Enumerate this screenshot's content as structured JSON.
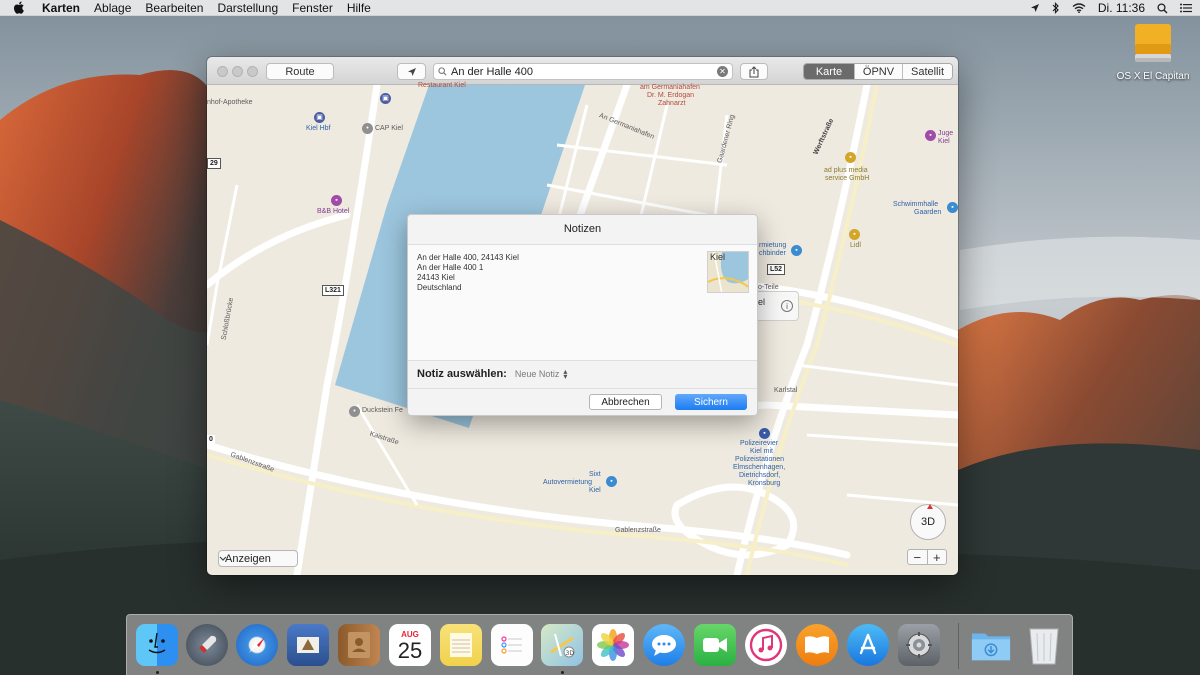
{
  "menubar": {
    "app_name": "Karten",
    "menus": [
      "Ablage",
      "Bearbeiten",
      "Darstellung",
      "Fenster",
      "Hilfe"
    ],
    "clock": "Di. 11:36"
  },
  "desktop": {
    "drive_label": "OS X El Capitan"
  },
  "window": {
    "route_label": "Route",
    "search_value": "An der Halle 400",
    "view_tabs": [
      "Karte",
      "ÖPNV",
      "Satellit"
    ],
    "active_view": "Karte",
    "display_menu": "Anzeigen",
    "btn_3d": "3D",
    "zoom_out": "−",
    "zoom_in": "+"
  },
  "map_labels": {
    "restaurant": "Restaurant Kiel",
    "apotheke": "nhof-Apotheke",
    "kiel_hbf": "Kiel Hbf",
    "cap_kiel": "CAP Kiel",
    "bb_hotel": "B&B Hotel",
    "dentist_1": "am Germaniahafen",
    "dentist_2": "Dr. M. Erdogan",
    "dentist_3": "Zahnarzt",
    "an_germaniahafen": "An Germaniahafen",
    "gaarden_ring": "Gaardener Ring",
    "werftstrasse": "Werftstraße",
    "ad_plus_1": "ad plus media",
    "ad_plus_2": "service GmbH",
    "juge_1": "Juge",
    "juge_2": "Kiel",
    "schwimm_1": "Schwimmhalle",
    "schwimm_2": "Gaarden",
    "lidl": "Lidl",
    "autover_1": "rmietung",
    "autover_2": "chbinder",
    "l52": "L52",
    "l321": "L321",
    "road_29": "29",
    "schlossbrucke": "Schloßbrücke",
    "duckstein": "Duckstein Fe",
    "kaistrasse": "Kaistraße",
    "gablenz_1": "Gablenzstraße",
    "gablenz_2": "Gablenzstraße",
    "karlstal": "Karlstal",
    "polizei_1": "Polizeirevier",
    "polizei_2": "Kiel mit",
    "polizei_3": "Polizeistationen",
    "polizei_4": "Elmschenhagen,",
    "polizei_5": "Dietrichsdorf,",
    "polizei_6": "Kronsburg",
    "sixt_1": "Sixt",
    "sixt_2": "Autovermietung",
    "sixt_3": "Kiel",
    "teile": "o-Teile",
    "callout_el": "el",
    "small_0": "0"
  },
  "notes_sheet": {
    "title": "Notizen",
    "address_lines": [
      "An der Halle 400, 24143 Kiel",
      "An der Halle 400 1",
      "24143 Kiel",
      "Deutschland"
    ],
    "thumbnail_label": "Kiel",
    "choose_label": "Notiz auswählen:",
    "choose_value": "Neue Notiz",
    "cancel": "Abbrechen",
    "save": "Sichern"
  },
  "dock": {
    "apps": [
      "Finder",
      "Launchpad",
      "Safari",
      "Mail",
      "Kontakte",
      "Kalender",
      "Notizen",
      "Erinnerungen",
      "Karten",
      "Fotos",
      "Nachrichten",
      "FaceTime",
      "iTunes",
      "iBooks",
      "App Store",
      "Systemeinstellungen",
      "Downloads",
      "Papierkorb"
    ],
    "calendar_month": "AUG",
    "calendar_day": "25"
  },
  "colors": {
    "accent_blue": "#1c7cf3",
    "map_water": "#9cc6de",
    "map_land": "#efeae0"
  }
}
